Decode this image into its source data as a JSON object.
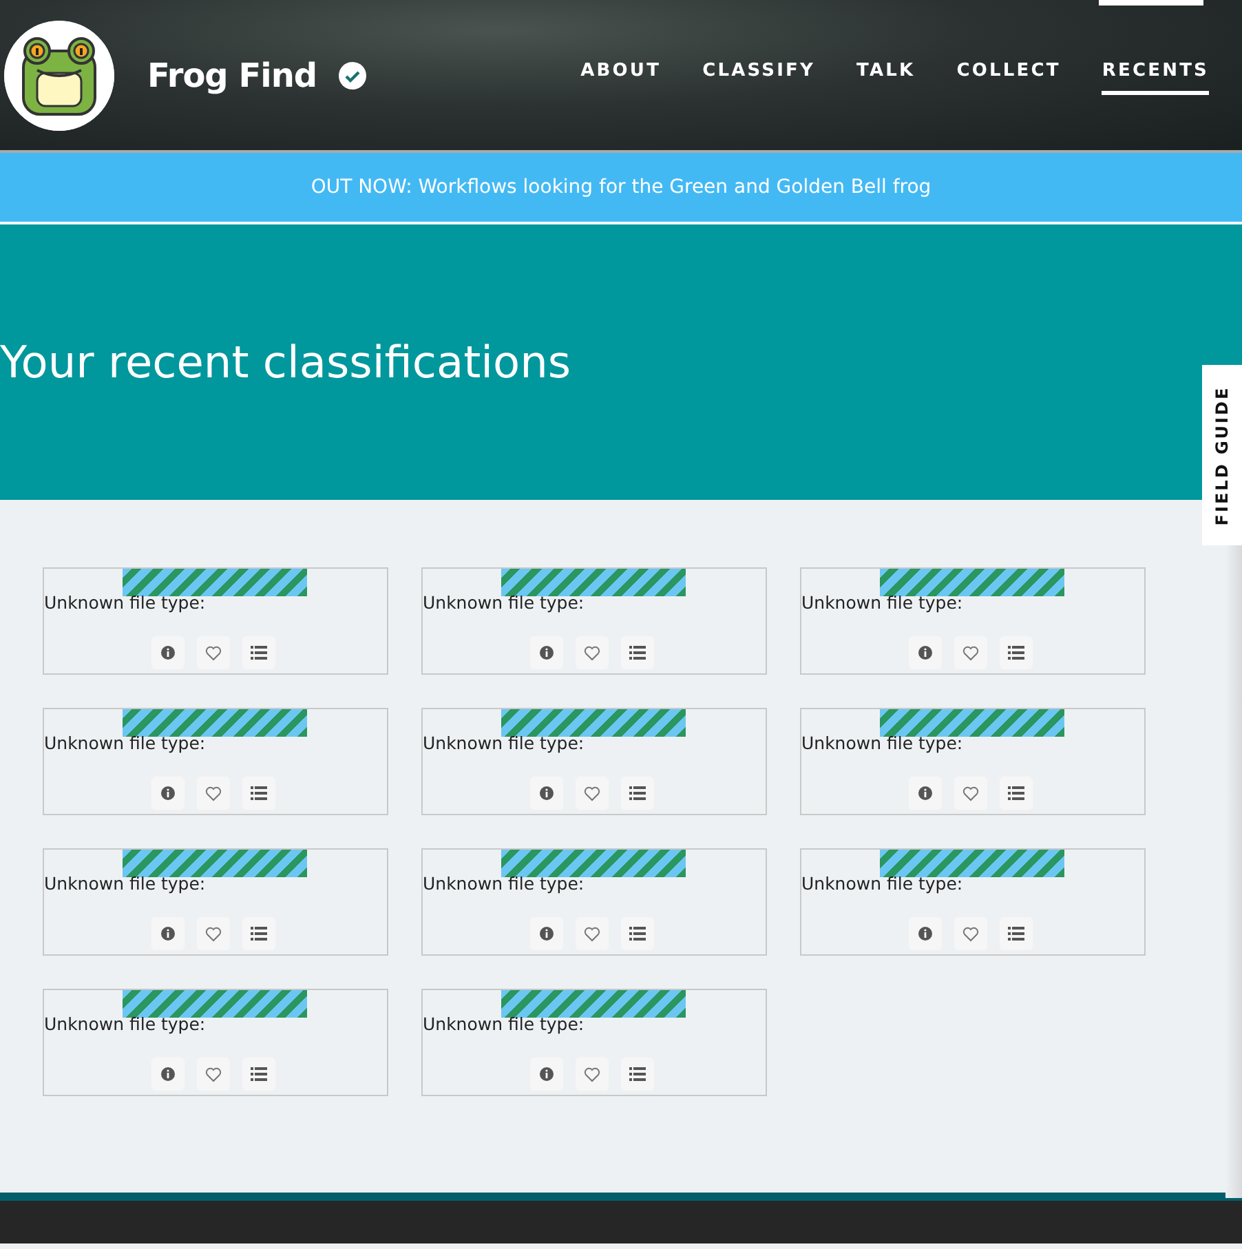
{
  "header": {
    "project_title": "Frog Find",
    "verified": true,
    "nav": [
      {
        "label": "ABOUT",
        "selected": false
      },
      {
        "label": "CLASSIFY",
        "selected": false
      },
      {
        "label": "TALK",
        "selected": false
      },
      {
        "label": "COLLECT",
        "selected": false
      },
      {
        "label": "RECENTS",
        "selected": true
      }
    ]
  },
  "announcement": "OUT NOW: Workflows looking for the Green and Golden Bell frog",
  "hero": {
    "title": "Your recent classifications"
  },
  "field_guide": "FIELD GUIDE",
  "classifications": [
    {
      "message": "Unknown file type:"
    },
    {
      "message": "Unknown file type:"
    },
    {
      "message": "Unknown file type:"
    },
    {
      "message": "Unknown file type:"
    },
    {
      "message": "Unknown file type:"
    },
    {
      "message": "Unknown file type:"
    },
    {
      "message": "Unknown file type:"
    },
    {
      "message": "Unknown file type:"
    },
    {
      "message": "Unknown file type:"
    },
    {
      "message": "Unknown file type:"
    },
    {
      "message": "Unknown file type:"
    }
  ]
}
